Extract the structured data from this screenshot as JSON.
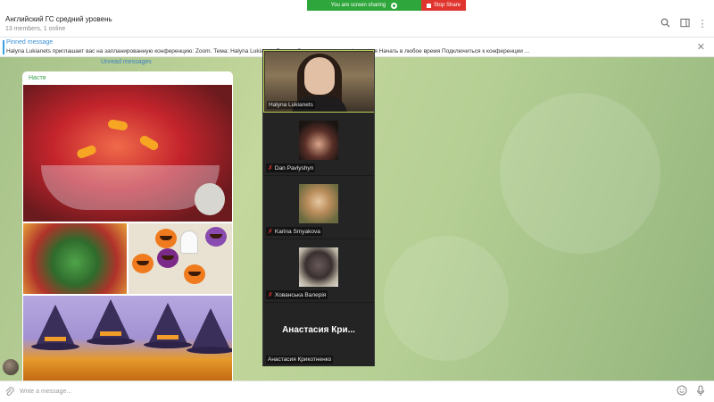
{
  "screen_share": {
    "status": "You are screen sharing",
    "stop_label": "Stop Share"
  },
  "header": {
    "title": "Английский ГС средний уровень",
    "subtitle": "13 members, 1 online"
  },
  "pinned": {
    "title": "Pinned message",
    "text": "Halyna Lukianets приглашает вас на запланированную конференцию: Zoom. Тема: Halyna Lukianets Время: Это регулярная конференция Начать в любое время  Подключиться к конференции ..."
  },
  "chat": {
    "unread_label": "Unread messages",
    "message": {
      "sender": "Настя"
    }
  },
  "participants": [
    {
      "name": "Halyna Lukianets",
      "muted": false,
      "active": true
    },
    {
      "name": "Dan Pavlyshyn",
      "muted": true
    },
    {
      "name": "Karina Smyakova",
      "muted": true
    },
    {
      "name": "Хованська Валерія",
      "muted": true
    },
    {
      "name": "Анастасия Крикотненко",
      "display": "Анастасия  Кри...",
      "muted": false
    }
  ],
  "composer": {
    "placeholder": "Write a message..."
  },
  "icons": [
    "search-icon",
    "sidebar-toggle-icon",
    "more-icon",
    "close-icon",
    "attach-icon",
    "emoji-icon",
    "mic-icon",
    "mic-off-icon"
  ]
}
